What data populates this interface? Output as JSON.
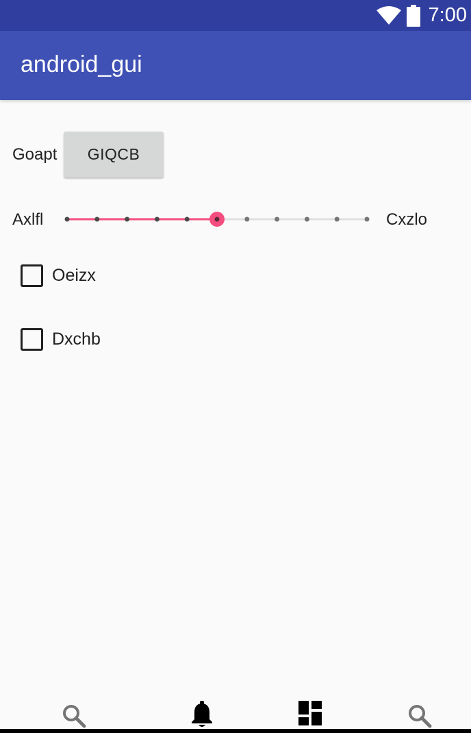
{
  "status_bar": {
    "time": "7:00",
    "icons": [
      "wifi-icon",
      "battery-icon"
    ],
    "color": "#303f9f"
  },
  "app_bar": {
    "title": "android_gui",
    "color": "#3f51b5"
  },
  "button_row": {
    "label": "Goapt",
    "button_label": "GIQCB"
  },
  "seekbar": {
    "left_label": "Axlfl",
    "right_label": "Cxzlo",
    "steps": 10,
    "value": 5,
    "active_color": "#f44d7f",
    "inactive_color": "#e0e0e0"
  },
  "checkboxes": [
    {
      "label": "Oeizx",
      "checked": false
    },
    {
      "label": "Dxchb",
      "checked": false
    }
  ],
  "bottom_nav": {
    "items": [
      "search-icon",
      "bell-icon",
      "dashboard-icon",
      "search-icon"
    ]
  }
}
